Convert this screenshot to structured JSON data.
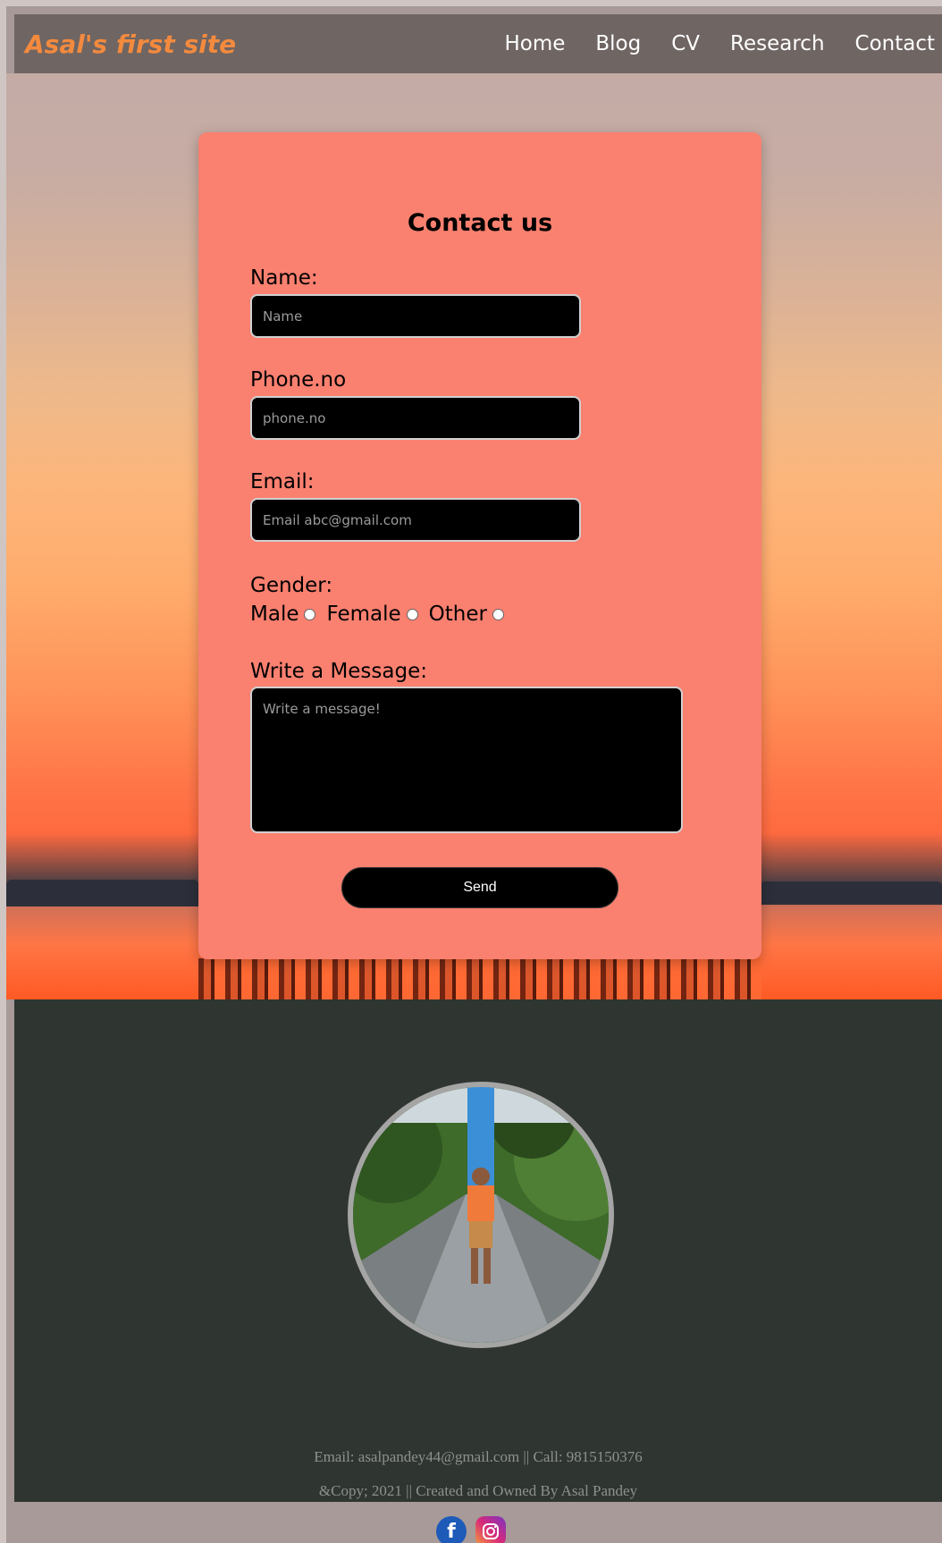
{
  "header": {
    "brand": "Asal's first site",
    "nav": [
      "Home",
      "Blog",
      "CV",
      "Research",
      "Contact"
    ]
  },
  "form": {
    "title": "Contact us",
    "name_label": "Name:",
    "name_placeholder": "Name",
    "phone_label": "Phone.no",
    "phone_placeholder": "phone.no",
    "email_label": "Email:",
    "email_placeholder": "Email abc@gmail.com",
    "gender_label": "Gender:",
    "gender_options": [
      "Male",
      "Female",
      "Other"
    ],
    "message_label": "Write a Message:",
    "message_placeholder": "Write a message!",
    "send_label": "Send"
  },
  "footer": {
    "contact": "Email: asalpandey44@gmail.com || Call: 9815150376",
    "copyright": "&Copy; 2021 || Created and Owned By Asal Pandey"
  },
  "social": [
    "facebook-icon",
    "instagram-icon"
  ],
  "colors": {
    "header_bg": "#6f6563",
    "brand": "#f38a3e",
    "card_bg": "#fa8070",
    "footer_bg": "#2f3530"
  }
}
